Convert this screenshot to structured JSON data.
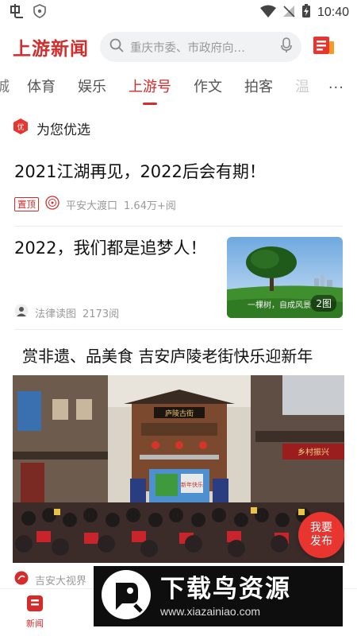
{
  "status_bar": {
    "time": "10:40"
  },
  "header": {
    "app_title": "上游新闻",
    "search_placeholder": "重庆市委、市政府向…"
  },
  "tabs": [
    {
      "label": "城",
      "state": "partial"
    },
    {
      "label": "体育",
      "state": "normal"
    },
    {
      "label": "娱乐",
      "state": "normal"
    },
    {
      "label": "上游号",
      "state": "active"
    },
    {
      "label": "作文",
      "state": "normal"
    },
    {
      "label": "拍客",
      "state": "normal"
    },
    {
      "label": "温",
      "state": "faded"
    }
  ],
  "tabs_more": "···",
  "section": {
    "badge": "优",
    "title": "为您优选"
  },
  "articles": [
    {
      "title": "2021江湖再见，2022后会有期！",
      "badge": "置顶",
      "source": "平安大渡口",
      "stats": "1.64万+阅"
    },
    {
      "title": "2022，我们都是追梦人！",
      "source": "法律读图",
      "stats": "2173阅",
      "image_count": "2图",
      "image_caption": "一棵树，自成风景"
    },
    {
      "title": "赏非遗、品美食 吉安庐陵老街快乐迎新年",
      "source": "吉安大视界",
      "photo_text": {
        "plaque": "庐陵古街",
        "screen": "新年快乐",
        "right_sign": "乡村振兴"
      }
    }
  ],
  "publish_button": {
    "line1": "我要",
    "line2": "发布"
  },
  "bottom_nav": {
    "active_label": "新闻"
  },
  "watermark": {
    "title": "下载鸟资源",
    "url": "www.xiazainiao.com"
  },
  "colors": {
    "brand_red": "#d52b2b",
    "publish_red": "#e8352f"
  }
}
